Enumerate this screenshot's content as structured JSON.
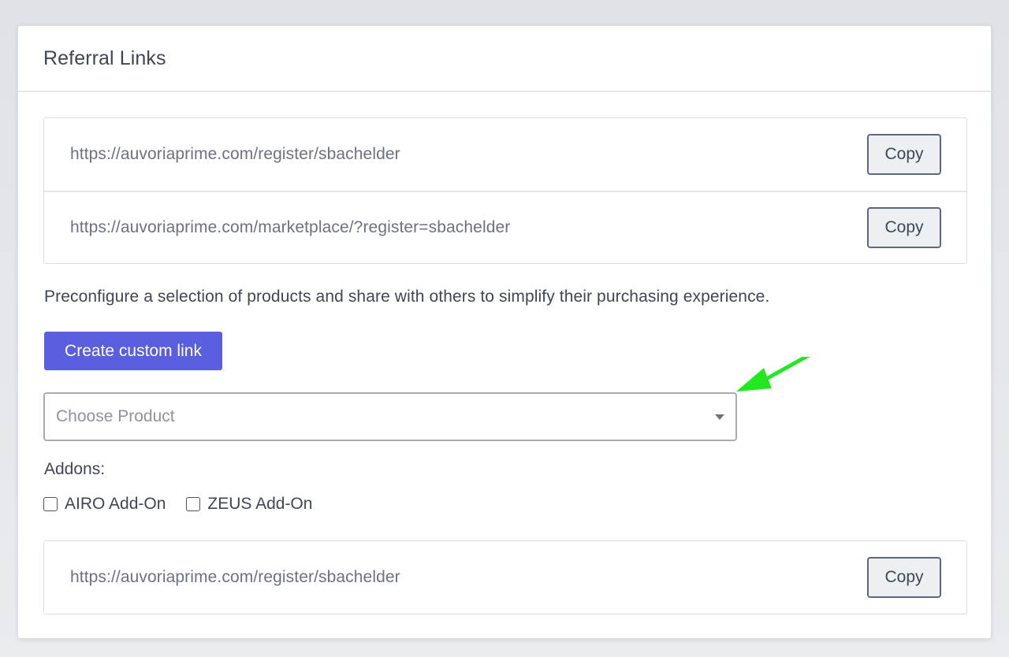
{
  "card": {
    "title": "Referral Links"
  },
  "referral_links": [
    {
      "url": "https://auvoriaprime.com/register/sbachelder",
      "copy_label": "Copy"
    },
    {
      "url": "https://auvoriaprime.com/marketplace/?register=sbachelder",
      "copy_label": "Copy"
    }
  ],
  "custom_link": {
    "description": "Preconfigure a selection of products and share with others to simplify their purchasing experience.",
    "create_button_label": "Create custom link",
    "product_select_placeholder": "Choose Product",
    "addons_label": "Addons:",
    "addons": [
      {
        "label": "AIRO Add-On",
        "checked": false
      },
      {
        "label": "ZEUS Add-On",
        "checked": false
      }
    ],
    "generated_link": {
      "url": "https://auvoriaprime.com/register/sbachelder",
      "copy_label": "Copy"
    }
  },
  "annotation": {
    "arrow_color": "#22e81f"
  },
  "colors": {
    "primary": "#5a5fe0",
    "page_bg": "#e5e7eb"
  }
}
